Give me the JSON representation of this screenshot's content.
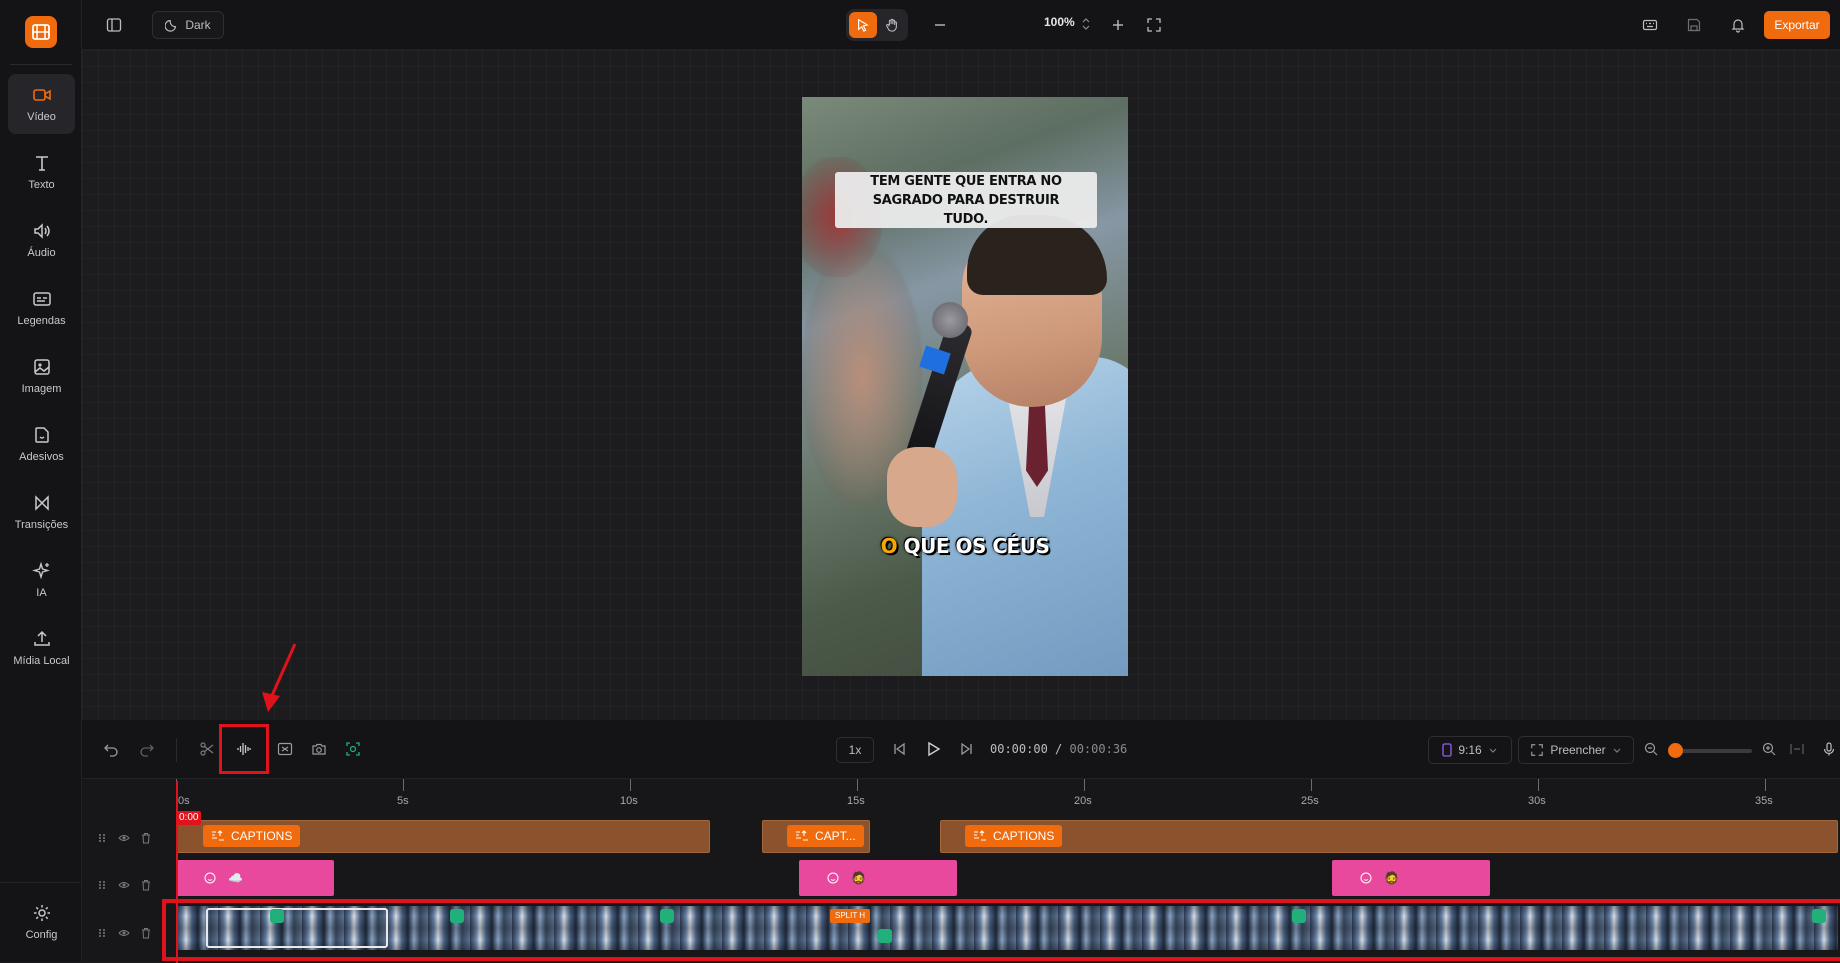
{
  "sidebar": {
    "items": [
      {
        "label": "Vídeo",
        "icon": "video-icon",
        "active": true
      },
      {
        "label": "Texto",
        "icon": "text-icon",
        "active": false
      },
      {
        "label": "Áudio",
        "icon": "audio-icon",
        "active": false
      },
      {
        "label": "Legendas",
        "icon": "captions-icon",
        "active": false
      },
      {
        "label": "Imagem",
        "icon": "image-icon",
        "active": false
      },
      {
        "label": "Adesivos",
        "icon": "sticker-icon",
        "active": false
      },
      {
        "label": "Transições",
        "icon": "transition-icon",
        "active": false
      },
      {
        "label": "IA",
        "icon": "sparkles-icon",
        "active": false
      },
      {
        "label": "Mídia Local",
        "icon": "upload-icon",
        "active": false
      }
    ],
    "config_label": "Config"
  },
  "topbar": {
    "theme_label": "Dark",
    "zoom": "100%",
    "export_label": "Exportar"
  },
  "preview": {
    "caption_top": "TEM GENTE QUE ENTRA NO SAGRADO PARA DESTRUIR TUDO.",
    "caption_bottom_highlight": "O",
    "caption_bottom_rest": "QUE OS CÉUS"
  },
  "controls": {
    "speed": "1x",
    "current_time": "00:00:00",
    "total_time": "00:00:36",
    "ratio": "9:16",
    "fill_mode": "Preencher"
  },
  "timeline": {
    "ruler": [
      "0s",
      "5s",
      "10s",
      "15s",
      "20s",
      "25s",
      "30s",
      "35s"
    ],
    "playhead_label": "0:00",
    "caption_clips": [
      {
        "label": "CAPTIONS"
      },
      {
        "label": "CAPT..."
      },
      {
        "label": "CAPTIONS"
      }
    ],
    "pink_clips": [
      {
        "emoji": "☁️"
      },
      {
        "emoji": "🧔"
      },
      {
        "emoji": "🧔"
      }
    ],
    "split_label": "SPLIT H"
  },
  "colors": {
    "accent": "#f06a0e",
    "highlight_red": "#e0121c",
    "caption_clip": "#8b532d",
    "pink_clip": "#e8499d"
  }
}
